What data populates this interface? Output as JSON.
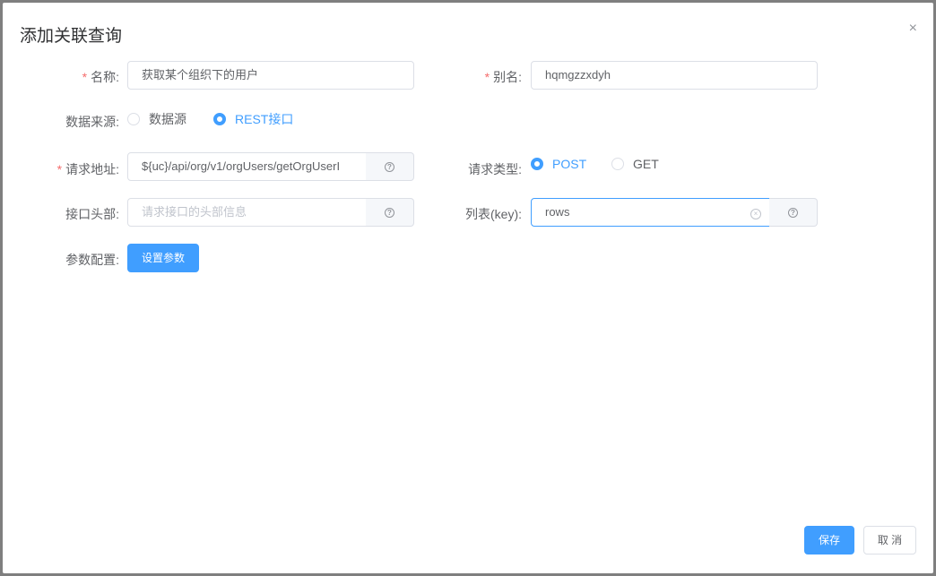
{
  "dialog": {
    "title": "添加关联查询",
    "close": "×"
  },
  "form": {
    "name": {
      "label": "名称:",
      "value": "获取某个组织下的用户"
    },
    "alias": {
      "label": "别名:",
      "value": "hqmgzzxdyh"
    },
    "source": {
      "label": "数据来源:",
      "options": [
        "数据源",
        "REST接口"
      ],
      "selected": "REST接口"
    },
    "url": {
      "label": "请求地址:",
      "value": "${uc}/api/org/v1/orgUsers/getOrgUserI"
    },
    "method": {
      "label": "请求类型:",
      "options": [
        "POST",
        "GET"
      ],
      "selected": "POST"
    },
    "headers": {
      "label": "接口头部:",
      "placeholder": "请求接口的头部信息"
    },
    "listKey": {
      "label": "列表(key):",
      "value": "rows"
    },
    "params": {
      "label": "参数配置:",
      "button": "设置参数"
    },
    "help": "?",
    "clear": "×"
  },
  "footer": {
    "save": "保存",
    "cancel": "取 消"
  }
}
